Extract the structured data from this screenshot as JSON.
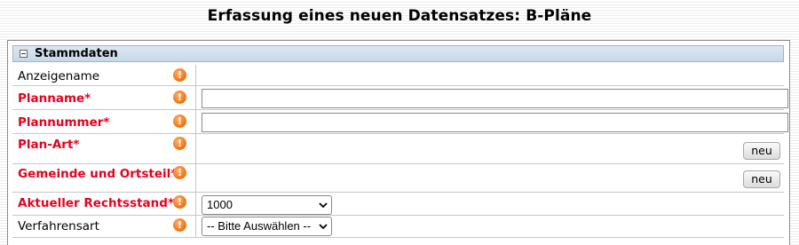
{
  "page": {
    "title": "Erfassung eines neuen Datensatzes: B-Pläne"
  },
  "panel": {
    "title": "Stammdaten"
  },
  "fields": {
    "anzeigename": {
      "label": "Anzeigename"
    },
    "planname": {
      "label": "Planname*",
      "value": ""
    },
    "plannummer": {
      "label": "Plannummer*",
      "value": ""
    },
    "plan_art": {
      "label": "Plan-Art*",
      "button": "neu"
    },
    "gemeinde": {
      "label": "Gemeinde und Ortsteil*",
      "button": "neu"
    },
    "rechtsstand": {
      "label": "Aktueller Rechtsstand*",
      "selected": "1000"
    },
    "verfahrensart": {
      "label": "Verfahrensart",
      "selected": "-- Bitte Auswählen --"
    }
  },
  "icons": {
    "info": "exclamation-info-icon",
    "collapse": "collapse-minus-icon"
  },
  "colors": {
    "required": "#e8001c",
    "info": "#f07a18",
    "header": "#c8d8e8"
  }
}
